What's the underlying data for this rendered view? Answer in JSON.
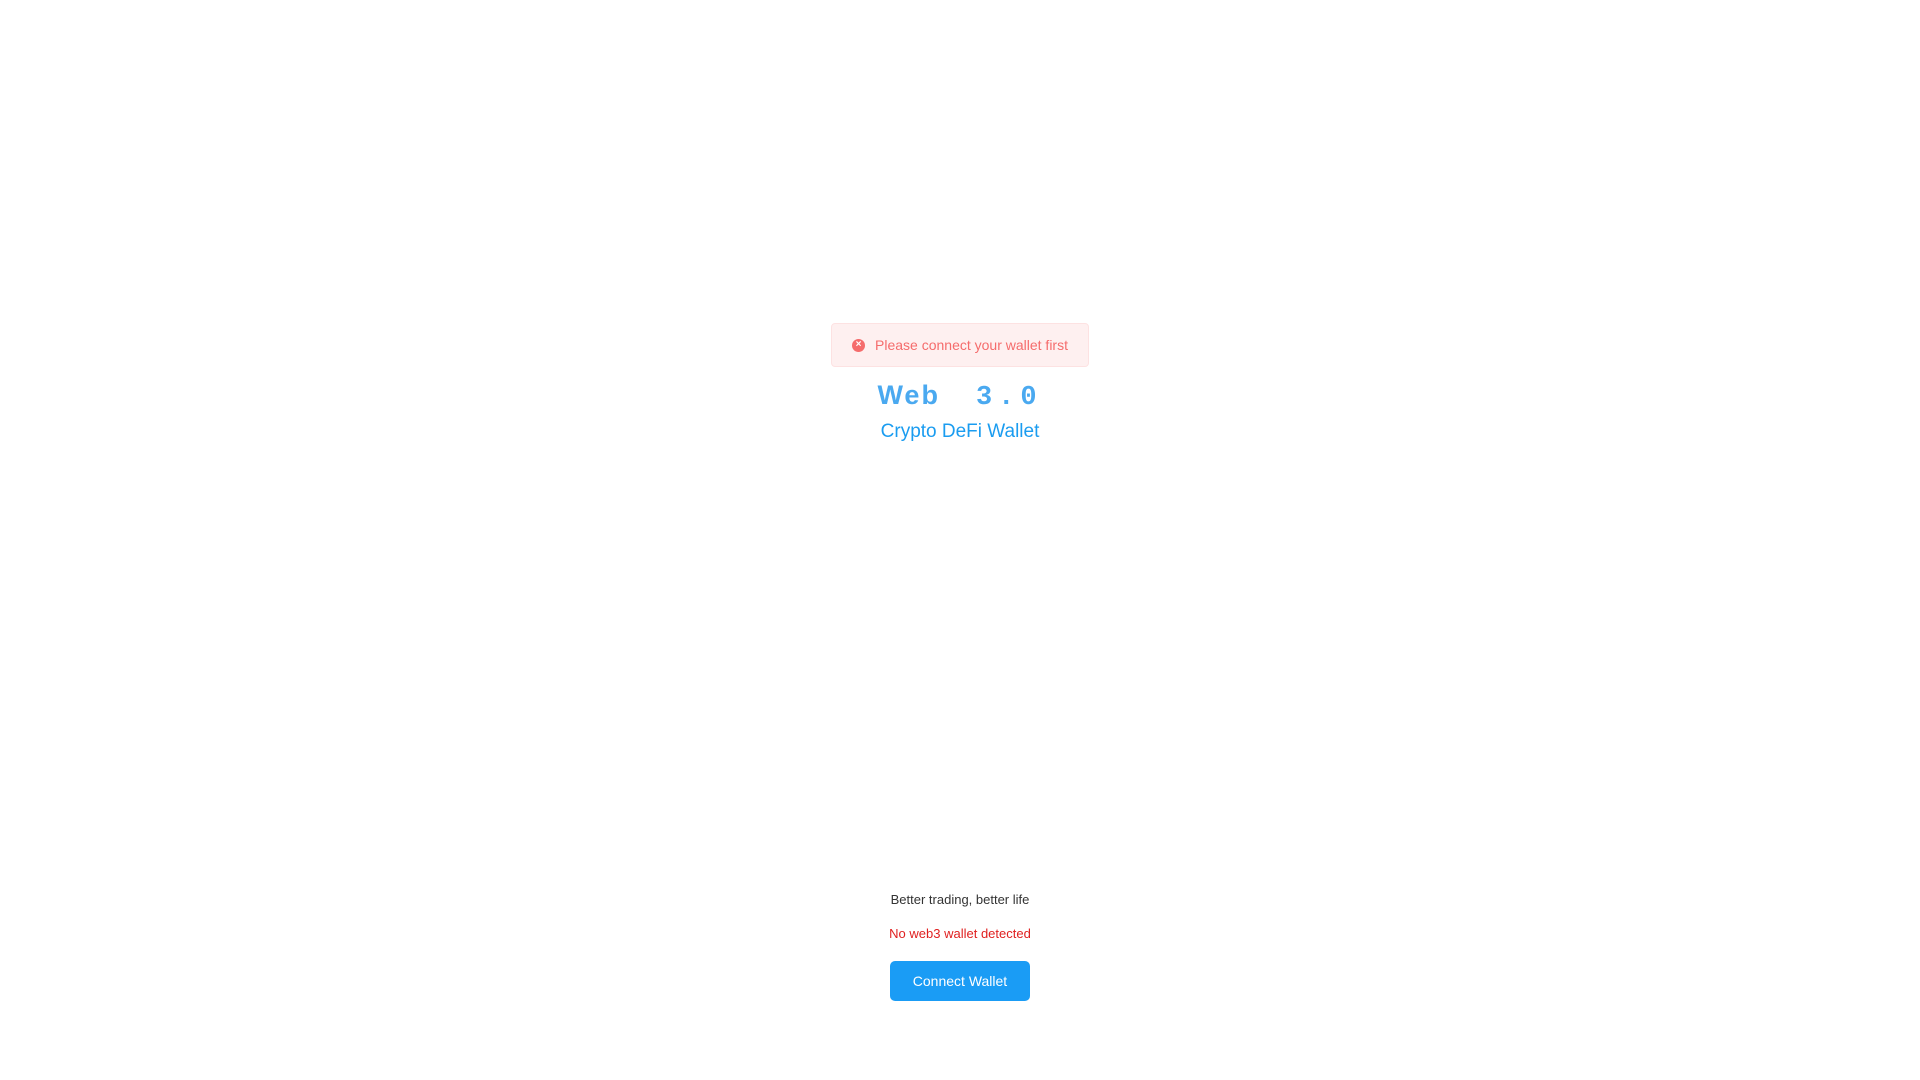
{
  "toast": {
    "icon": "error-circle-icon",
    "message": "Please connect your wallet first",
    "color": "#f56c6c",
    "background": "#fef0f0"
  },
  "brand": {
    "title_word": "Web",
    "title_version": "3.0",
    "subtitle": "Crypto DeFi Wallet",
    "color": "#4aa9f0"
  },
  "footer": {
    "tagline": "Better trading, better life",
    "warning": "No web3 wallet detected",
    "warning_color": "#e02020",
    "connect_label": "Connect Wallet",
    "button_color": "#1a9cf5"
  }
}
